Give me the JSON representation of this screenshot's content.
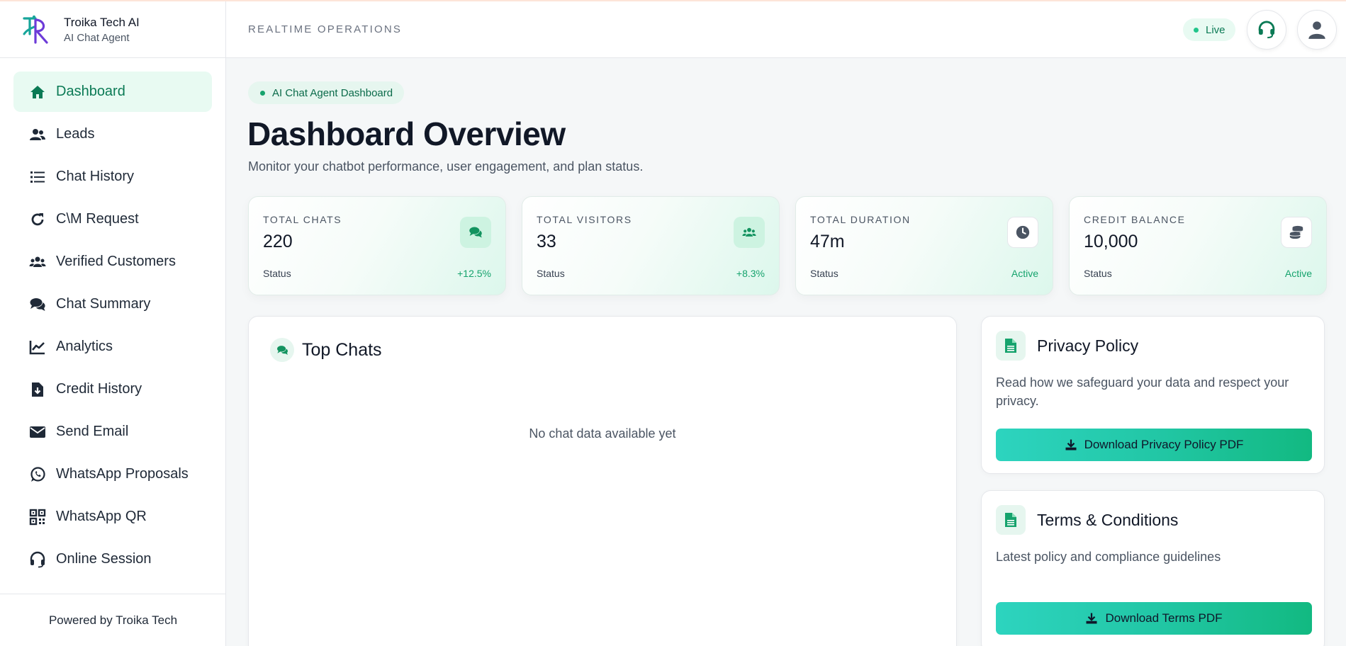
{
  "brand": {
    "name": "Troika Tech AI",
    "subtitle": "AI Chat Agent"
  },
  "sidebar": {
    "items": [
      {
        "label": "Dashboard",
        "icon": "home-icon",
        "active": true
      },
      {
        "label": "Leads",
        "icon": "users-icon"
      },
      {
        "label": "Chat History",
        "icon": "list-icon"
      },
      {
        "label": "C\\M Request",
        "icon": "refresh-icon"
      },
      {
        "label": "Verified Customers",
        "icon": "user-group-icon"
      },
      {
        "label": "Chat Summary",
        "icon": "comments-icon"
      },
      {
        "label": "Analytics",
        "icon": "line-chart-icon"
      },
      {
        "label": "Credit History",
        "icon": "file-download-icon"
      },
      {
        "label": "Send Email",
        "icon": "envelope-icon"
      },
      {
        "label": "WhatsApp Proposals",
        "icon": "whatsapp-icon"
      },
      {
        "label": "WhatsApp QR",
        "icon": "qrcode-icon"
      },
      {
        "label": "Online Session",
        "icon": "headset-icon"
      }
    ],
    "footer": "Powered by Troika Tech"
  },
  "header": {
    "title": "REALTIME OPERATIONS",
    "live_label": "Live"
  },
  "main": {
    "breadcrumb": "AI Chat Agent Dashboard",
    "title": "Dashboard Overview",
    "subtitle": "Monitor your chatbot performance, user engagement, and plan status.",
    "stats": [
      {
        "label": "TOTAL CHATS",
        "value": "220",
        "status": "Status",
        "change": "+12.5%",
        "icon": "comments-icon"
      },
      {
        "label": "TOTAL VISITORS",
        "value": "33",
        "status": "Status",
        "change": "+8.3%",
        "icon": "users-icon"
      },
      {
        "label": "TOTAL DURATION",
        "value": "47m",
        "status": "Status",
        "change": "Active",
        "icon": "clock-icon"
      },
      {
        "label": "CREDIT BALANCE",
        "value": "10,000",
        "status": "Status",
        "change": "Active",
        "icon": "coins-icon"
      }
    ],
    "top_chats": {
      "title": "Top Chats",
      "empty": "No chat data available yet"
    },
    "privacy": {
      "title": "Privacy Policy",
      "description": "Read how we safeguard your data and respect your privacy.",
      "button": "Download Privacy Policy PDF"
    },
    "terms": {
      "title": "Terms & Conditions",
      "description": "Latest policy and compliance guidelines",
      "button": "Download Terms PDF"
    }
  },
  "colors": {
    "accent": "#16a36d",
    "active_bg": "#e8faf2",
    "button_start": "#2dd4bf",
    "button_end": "#12b981"
  }
}
